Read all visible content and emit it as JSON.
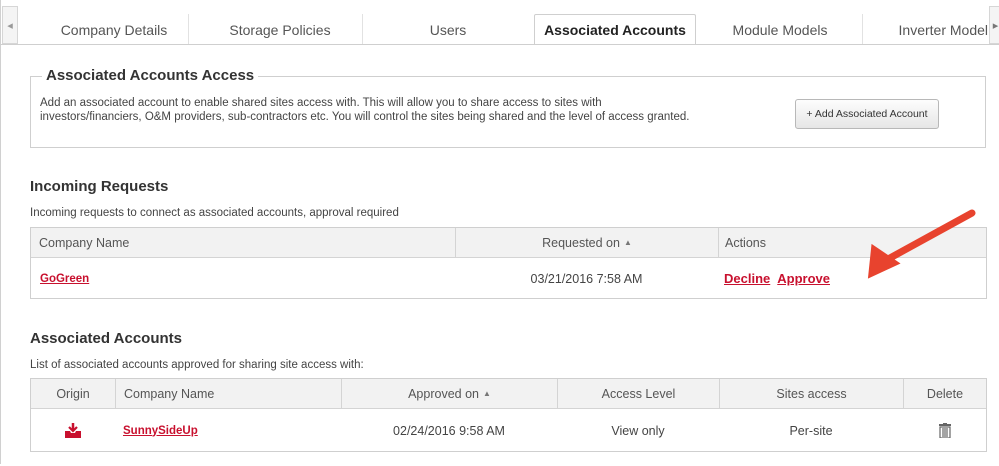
{
  "tabs": [
    {
      "label": "Company Details",
      "active": false
    },
    {
      "label": "Storage Policies",
      "active": false
    },
    {
      "label": "Users",
      "active": false
    },
    {
      "label": "Associated Accounts",
      "active": true
    },
    {
      "label": "Module Models",
      "active": false
    },
    {
      "label": "Inverter Model",
      "active": false
    }
  ],
  "access": {
    "title": "Associated Accounts Access",
    "description_line1": "Add an associated account to enable shared sites access with. This will allow you to share access to sites with",
    "description_line2": "investors/financiers, O&M providers, sub-contractors etc. You will control the sites being shared and the level of access granted.",
    "add_button": "+ Add Associated Account"
  },
  "incoming": {
    "title": "Incoming Requests",
    "description": "Incoming requests to connect as associated accounts, approval required",
    "columns": {
      "company": "Company Name",
      "requested": "Requested on",
      "actions": "Actions"
    },
    "sort_indicator": "▲",
    "rows": [
      {
        "company": "GoGreen",
        "requested": "03/21/2016 7:58 AM",
        "decline": "Decline",
        "approve": "Approve"
      }
    ]
  },
  "associated": {
    "title": "Associated Accounts",
    "description": "List of associated accounts approved for sharing site access with:",
    "columns": {
      "origin": "Origin",
      "company": "Company Name",
      "approved": "Approved on",
      "access": "Access Level",
      "sites": "Sites access",
      "delete": "Delete"
    },
    "sort_indicator": "▲",
    "rows": [
      {
        "origin_icon": "inbox-download-icon",
        "company": "SunnySideUp",
        "approved": "02/24/2016 9:58 AM",
        "access": "View only",
        "sites": "Per-site",
        "delete_icon": "trash-icon"
      }
    ]
  },
  "colors": {
    "accent": "#c8102e",
    "arrow": "#e8432e",
    "header_bg": "#f2f2f2",
    "border": "#cfcfcf"
  }
}
